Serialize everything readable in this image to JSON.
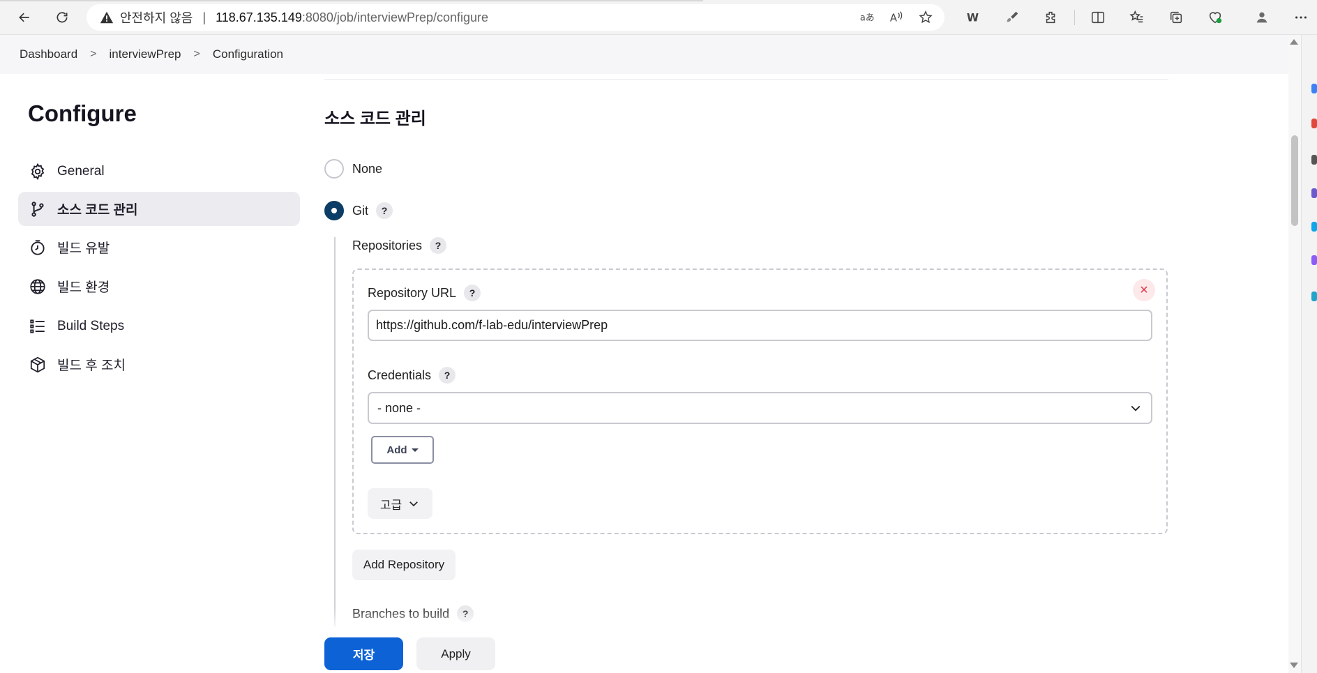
{
  "browser": {
    "security_label": "안전하지 않음",
    "url_host": "118.67.135.149",
    "url_path": ":8080/job/interviewPrep/configure",
    "icons": [
      "back-icon",
      "reload-icon",
      "warning-icon",
      "translate-icon",
      "read-aloud-icon",
      "favorite-star-icon",
      "w-extension-icon",
      "brush-extension-icon",
      "extensions-icon",
      "split-screen-icon",
      "favorites-icon",
      "collections-icon",
      "browser-essentials-icon",
      "profile-icon",
      "more-icon"
    ]
  },
  "breadcrumbs": [
    "Dashboard",
    "interviewPrep",
    "Configuration"
  ],
  "sidebar": {
    "title": "Configure",
    "items": [
      {
        "label": "General",
        "icon": "gear-icon",
        "active": false
      },
      {
        "label": "소스 코드 관리",
        "icon": "source-branch-icon",
        "active": true
      },
      {
        "label": "빌드 유발",
        "icon": "timer-icon",
        "active": false
      },
      {
        "label": "빌드 환경",
        "icon": "globe-icon",
        "active": false
      },
      {
        "label": "Build Steps",
        "icon": "list-icon",
        "active": false
      },
      {
        "label": "빌드 후 조치",
        "icon": "package-icon",
        "active": false
      }
    ]
  },
  "scm": {
    "section_title": "소스 코드 관리",
    "options": [
      {
        "label": "None",
        "checked": false
      },
      {
        "label": "Git",
        "checked": true,
        "help": "?"
      }
    ],
    "repositories_label": "Repositories",
    "repository_url_label": "Repository URL",
    "repository_url_value": "https://github.com/f-lab-edu/interviewPrep",
    "credentials_label": "Credentials",
    "credentials_value": "- none -",
    "add_label": "Add",
    "advanced_label": "고급",
    "add_repository_label": "Add Repository",
    "branches_label": "Branches to build",
    "help_text": "?",
    "remove_icon": "×"
  },
  "footer": {
    "save_label": "저장",
    "apply_label": "Apply"
  },
  "colors": {
    "primary": "#0d63d6",
    "radio_checked": "#0b3d66",
    "remove": "#e0303f"
  }
}
